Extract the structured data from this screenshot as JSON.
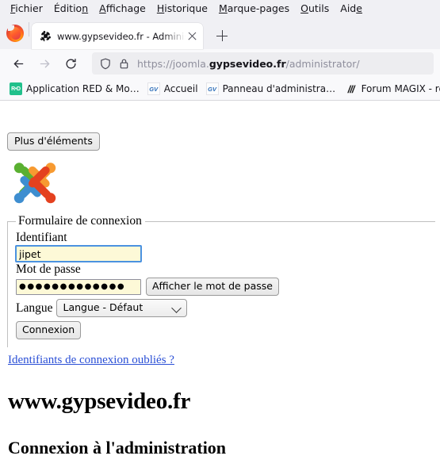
{
  "menubar": {
    "items": [
      {
        "label": "Fichier",
        "accel_index": 0
      },
      {
        "label": "Édition",
        "accel_index": 6
      },
      {
        "label": "Affichage",
        "accel_index": 0
      },
      {
        "label": "Historique",
        "accel_index": 0
      },
      {
        "label": "Marque-pages",
        "accel_index": 0
      },
      {
        "label": "Outils",
        "accel_index": 0
      },
      {
        "label": "Aide",
        "accel_index": 3
      }
    ]
  },
  "tabstrip": {
    "app_icon": "firefox-logo",
    "tab": {
      "favicon": "joomla-favicon",
      "title": "www.gypsevideo.fr - Administra",
      "close_icon": "close-icon"
    },
    "new_tab_icon": "plus-icon"
  },
  "navbar": {
    "back_icon": "back-arrow-icon",
    "forward_icon": "forward-arrow-icon",
    "reload_icon": "reload-icon",
    "shield_icon": "shield-icon",
    "lock_icon": "padlock-icon",
    "url_prefix": "https://joomla.",
    "url_domain": "gypsevideo.fr",
    "url_suffix": "/administrator/"
  },
  "bookmarks": [
    {
      "icon": "red-app-icon",
      "icon_text": "R•D",
      "label": "Application RED & Mo…"
    },
    {
      "icon": "gv-icon",
      "icon_text": "GV",
      "label": "Accueil"
    },
    {
      "icon": "gv-icon",
      "icon_text": "GV",
      "label": "Panneau d'administrat…"
    },
    {
      "icon": "magix-icon",
      "icon_text": "///",
      "label": "Forum MAGIX - retrou…"
    }
  ],
  "page": {
    "more_elements_button": "Plus d'éléments",
    "logo": "joomla-logo",
    "form": {
      "legend": "Formulaire de connexion",
      "username_label": "Identifiant",
      "username_value": "jipet",
      "username_placeholder": "",
      "password_label": "Mot de passe",
      "password_masked": "●●●●●●●●●●●●●",
      "show_password_button": "Afficher le mot de passe",
      "language_label": "Langue",
      "language_selected": "Langue - Défaut",
      "language_options": [
        "Langue - Défaut"
      ],
      "submit_button": "Connexion"
    },
    "forgot_link": "Identifiants de connexion oubliés ?",
    "site_title": "www.gypsevideo.fr",
    "subtitle": "Connexion à l'administration"
  },
  "colors": {
    "accent_blue": "#2a4fd6",
    "autofill_yellow": "#fdf9d7",
    "focus_blue": "#4b92e0",
    "joomla_green": "#5ab031",
    "joomla_orange": "#f79a31",
    "joomla_blue": "#3e8ed0",
    "joomla_red": "#e4411f"
  }
}
